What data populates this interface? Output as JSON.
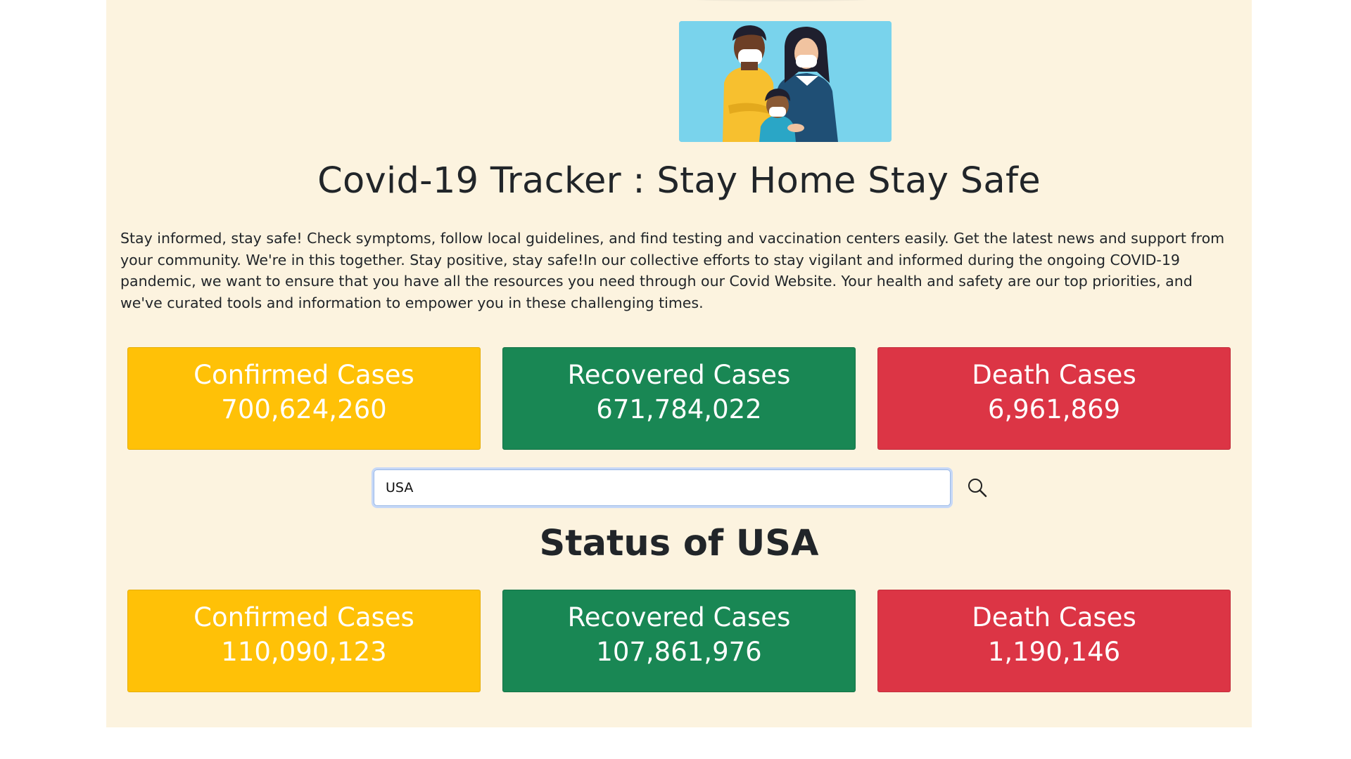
{
  "hero": {
    "image": "family-with-masks-illustration"
  },
  "page": {
    "title": "Covid-19 Tracker : Stay Home Stay Safe",
    "intro": "Stay informed, stay safe! Check symptoms, follow local guidelines, and find testing and vaccination centers easily. Get the latest news and support from your community. We're in this together. Stay positive, stay safe!In our collective efforts to stay vigilant and informed during the ongoing COVID-19 pandemic, we want to ensure that you have all the resources you need through our Covid Website. Your health and safety are our top priorities, and we've curated tools and information to empower you in these challenging times."
  },
  "global": {
    "confirmed": {
      "label": "Confirmed Cases",
      "value": "700,624,260",
      "color": "#ffc107"
    },
    "recovered": {
      "label": "Recovered Cases",
      "value": "671,784,022",
      "color": "#198754"
    },
    "deaths": {
      "label": "Death Cases",
      "value": "6,961,869",
      "color": "#dc3545"
    }
  },
  "search": {
    "value": "USA",
    "icon": "search-icon"
  },
  "country": {
    "status_title": "Status of USA",
    "confirmed": {
      "label": "Confirmed Cases",
      "value": "110,090,123"
    },
    "recovered": {
      "label": "Recovered Cases",
      "value": "107,861,976"
    },
    "deaths": {
      "label": "Death Cases",
      "value": "1,190,146"
    }
  }
}
